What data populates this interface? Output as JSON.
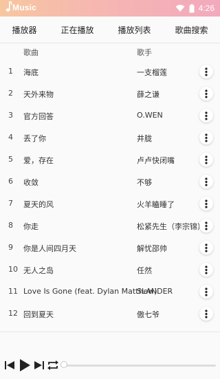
{
  "status_bar": {
    "app_name": "Music",
    "time": "4:26"
  },
  "tabs": [
    {
      "label": "播放器"
    },
    {
      "label": "正在播放"
    },
    {
      "label": "播放列表"
    },
    {
      "label": "歌曲搜索"
    }
  ],
  "list": {
    "header": {
      "title": "歌曲",
      "artist": "歌手"
    },
    "rows": [
      {
        "num": "1",
        "title": "海底",
        "artist": "一支榴莲"
      },
      {
        "num": "2",
        "title": "天外来物",
        "artist": "薛之谦"
      },
      {
        "num": "3",
        "title": "官方回答",
        "artist": "O.WEN"
      },
      {
        "num": "4",
        "title": "丢了你",
        "artist": "井胧"
      },
      {
        "num": "5",
        "title": "爱，存在",
        "artist": "卢卢快闭嘴"
      },
      {
        "num": "6",
        "title": "收敛",
        "artist": "不够"
      },
      {
        "num": "7",
        "title": "夏天的风",
        "artist": "火羊瞌睡了"
      },
      {
        "num": "8",
        "title": "你走",
        "artist": "松紧先生（李宗锦）"
      },
      {
        "num": "9",
        "title": "你是人间四月天",
        "artist": "解忧邵帅"
      },
      {
        "num": "10",
        "title": "无人之岛",
        "artist": "任然"
      },
      {
        "num": "11",
        "title": "Love Is Gone (feat. Dylan Matthew)",
        "artist": "SLANDER"
      },
      {
        "num": "12",
        "title": "回到夏天",
        "artist": "傲七爷"
      }
    ]
  },
  "player": {
    "progress": 0
  },
  "colors": {
    "status_gradient": [
      "#f7c7a0",
      "#f2a9bd"
    ],
    "control": "#222222"
  },
  "icons": [
    "music-note-icon",
    "wifi-icon",
    "battery-icon",
    "more-vert-icon",
    "skip-previous-icon",
    "play-icon",
    "skip-next-icon",
    "repeat-icon"
  ]
}
